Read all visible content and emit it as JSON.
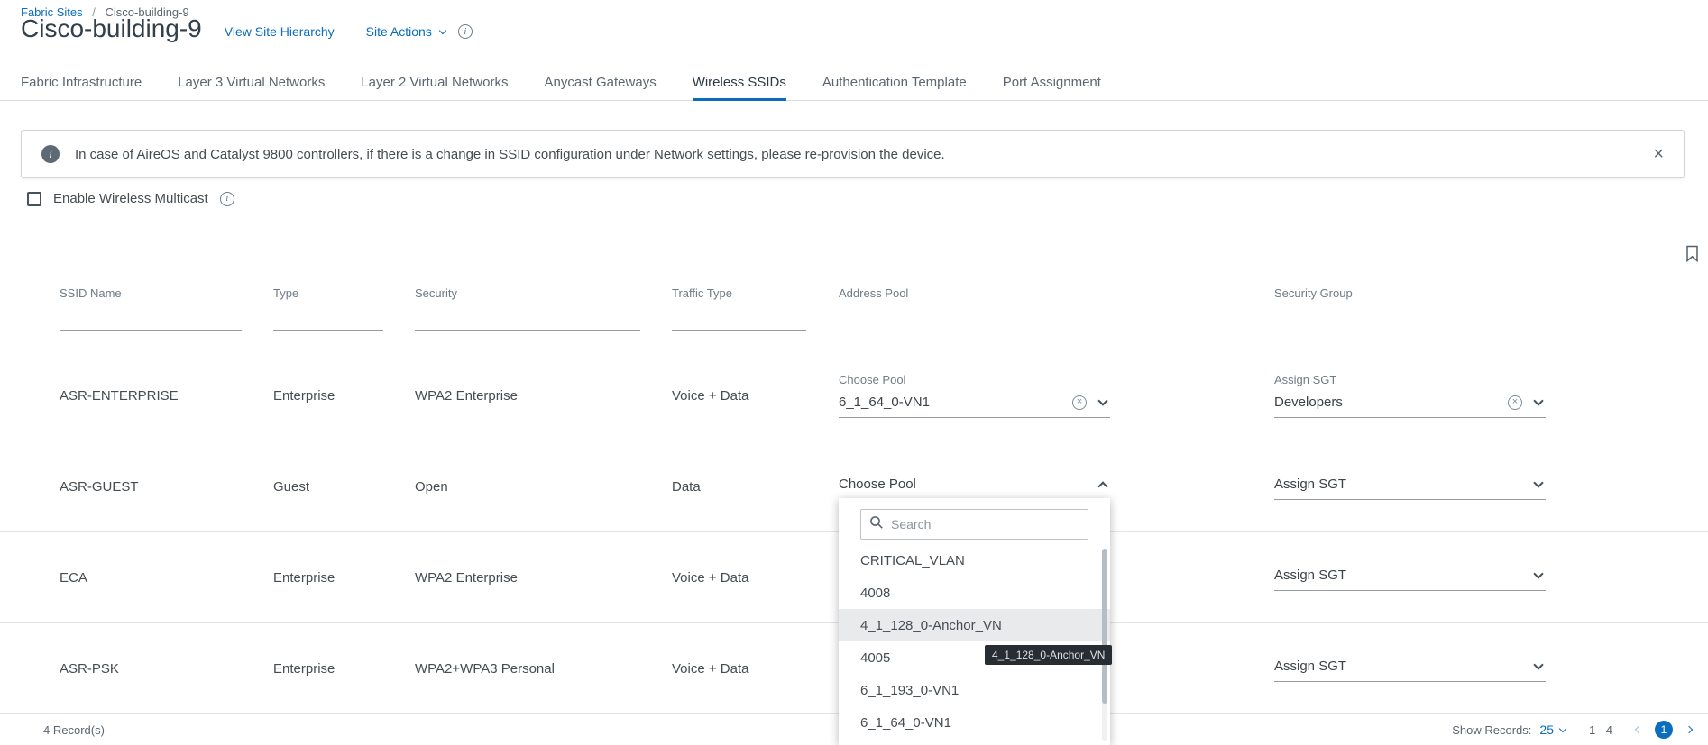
{
  "breadcrumb": {
    "root": "Fabric Sites",
    "separator": "/",
    "current": "Cisco-building-9"
  },
  "header": {
    "title": "Cisco-building-9",
    "view_site_hierarchy": "View Site Hierarchy",
    "site_actions": "Site Actions"
  },
  "tabs": [
    {
      "label": "Fabric Infrastructure",
      "active": false
    },
    {
      "label": "Layer 3 Virtual Networks",
      "active": false
    },
    {
      "label": "Layer 2 Virtual Networks",
      "active": false
    },
    {
      "label": "Anycast Gateways",
      "active": false
    },
    {
      "label": "Wireless SSIDs",
      "active": true
    },
    {
      "label": "Authentication Template",
      "active": false
    },
    {
      "label": "Port Assignment",
      "active": false
    }
  ],
  "alert": {
    "message": "In case of AireOS and Catalyst 9800 controllers, if there is a change in SSID configuration under Network settings, please re-provision the device."
  },
  "multicast": {
    "label": "Enable Wireless Multicast",
    "checked": false
  },
  "table": {
    "columns": [
      "SSID Name",
      "Type",
      "Security",
      "Traffic Type",
      "Address Pool",
      "Security Group"
    ],
    "rows": [
      {
        "ssid": "ASR-ENTERPRISE",
        "type": "Enterprise",
        "security": "WPA2 Enterprise",
        "traffic_type": "Voice + Data",
        "address_pool": {
          "label": "Choose Pool",
          "value": "6_1_64_0-VN1"
        },
        "security_group": {
          "label": "Assign SGT",
          "value": "Developers"
        }
      },
      {
        "ssid": "ASR-GUEST",
        "type": "Guest",
        "security": "Open",
        "traffic_type": "Data",
        "address_pool": {
          "value": "Choose Pool",
          "expanded": true
        },
        "security_group": {
          "value": "Assign SGT"
        }
      },
      {
        "ssid": "ECA",
        "type": "Enterprise",
        "security": "WPA2 Enterprise",
        "traffic_type": "Voice + Data",
        "security_group": {
          "value": "Assign SGT"
        }
      },
      {
        "ssid": "ASR-PSK",
        "type": "Enterprise",
        "security": "WPA2+WPA3 Personal",
        "traffic_type": "Voice + Data",
        "security_group": {
          "value": "Assign SGT"
        }
      }
    ]
  },
  "pool_dropdown": {
    "search_placeholder": "Search",
    "options": [
      "CRITICAL_VLAN",
      "4008",
      "4_1_128_0-Anchor_VN",
      "4005",
      "6_1_193_0-VN1",
      "6_1_64_0-VN1"
    ],
    "highlighted_option": "4_1_128_0-Anchor_VN",
    "tooltip": "4_1_128_0-Anchor_VN"
  },
  "footer": {
    "records_count": "4 Record(s)",
    "show_records_label": "Show Records:",
    "page_size": "25",
    "range": "1 - 4",
    "current_page": "1"
  },
  "icons": {
    "info": "i",
    "close": "×",
    "clear": "×"
  },
  "colors": {
    "link_blue": "#0b6dbd",
    "accent_blue": "#0b6dbd"
  }
}
